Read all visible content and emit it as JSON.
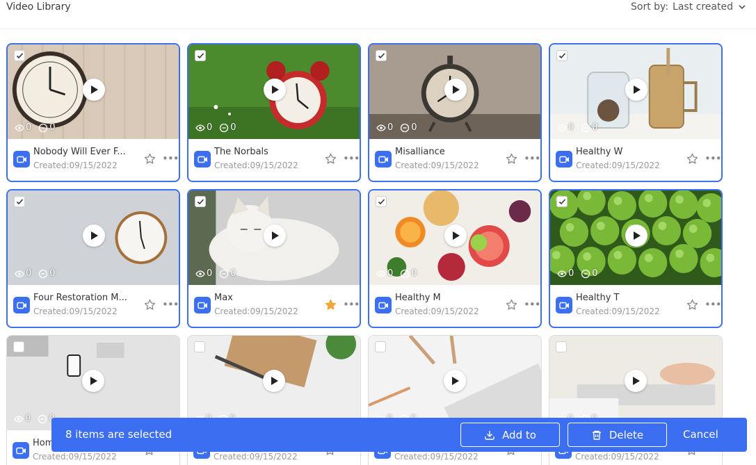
{
  "header": {
    "title": "Video Library",
    "sort_label": "Sort by:",
    "sort_value": "Last created"
  },
  "colors": {
    "accent": "#3b6ef0",
    "star_active": "#f0a63b"
  },
  "videos": [
    {
      "title": "Nobody Will Ever F...",
      "created": "Created:09/15/2022",
      "views": "0",
      "comments": "0",
      "selected": true,
      "starred": false,
      "thumb": "wall-clock"
    },
    {
      "title": "The Norbals",
      "created": "Created:09/15/2022",
      "views": "0",
      "comments": "0",
      "selected": true,
      "starred": false,
      "thumb": "red-alarm-clock"
    },
    {
      "title": "Misalliance",
      "created": "Created:09/15/2022",
      "views": "0",
      "comments": "0",
      "selected": true,
      "starred": false,
      "thumb": "vintage-alarm-clock"
    },
    {
      "title": "Healthy W",
      "created": "Created:09/15/2022",
      "views": "0",
      "comments": "0",
      "selected": true,
      "starred": false,
      "thumb": "jars"
    },
    {
      "title": "Four Restoration M...",
      "created": "Created:09/15/2022",
      "views": "0",
      "comments": "0",
      "selected": true,
      "starred": false,
      "thumb": "clock-on-wall"
    },
    {
      "title": "Max",
      "created": "Created:09/15/2022",
      "views": "0",
      "comments": "0",
      "selected": true,
      "starred": true,
      "thumb": "cat"
    },
    {
      "title": "Healthy M",
      "created": "Created:09/15/2022",
      "views": "0",
      "comments": "0",
      "selected": true,
      "starred": false,
      "thumb": "fruits"
    },
    {
      "title": "Healthy T",
      "created": "Created:09/15/2022",
      "views": "0",
      "comments": "0",
      "selected": true,
      "starred": false,
      "thumb": "green-apples"
    },
    {
      "title": "Hom",
      "created": "Created:09/15/2022",
      "views": "0",
      "comments": "0",
      "selected": false,
      "starred": false,
      "thumb": "desk-phone"
    },
    {
      "title": "",
      "created": "Created:09/15/2022",
      "views": "0",
      "comments": "0",
      "selected": false,
      "starred": false,
      "thumb": "notebook"
    },
    {
      "title": "",
      "created": "Created:09/15/2022",
      "views": "0",
      "comments": "0",
      "selected": false,
      "starred": false,
      "thumb": "keyboard-pens"
    },
    {
      "title": "",
      "created": "Created:09/15/2022",
      "views": "0",
      "comments": "0",
      "selected": false,
      "starred": false,
      "thumb": "typing-hands"
    }
  ],
  "actionbar": {
    "selected_text": "8 items are selected",
    "add_label": "Add to",
    "delete_label": "Delete",
    "cancel_label": "Cancel"
  }
}
